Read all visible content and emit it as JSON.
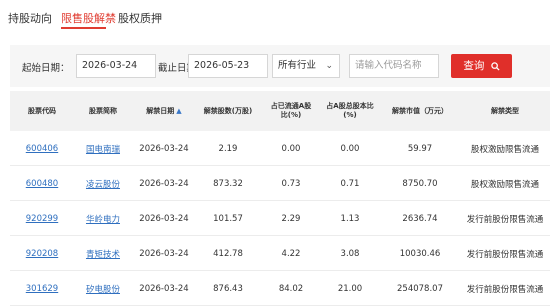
{
  "tabs": [
    {
      "label": "持股动向"
    },
    {
      "label": "限售股解禁"
    },
    {
      "label": "股权质押"
    }
  ],
  "filter": {
    "start_label": "起始日期：",
    "start_value": "2026-03-24",
    "end_label": "截止日期：",
    "end_value": "2026-05-23",
    "industry_value": "所有行业",
    "search_placeholder": "请输入代码名称",
    "query_label": "查询"
  },
  "table": {
    "headers": [
      "股票代码",
      "股票简称",
      "解禁日期",
      "解禁股数(万股)",
      "占已流通A股比(%)",
      "占A股总股本比(%)",
      "解禁市值（万元）",
      "解禁类型"
    ],
    "rows": [
      [
        "600406",
        "国电南瑞",
        "2026-03-24",
        "2.19",
        "0.00",
        "0.00",
        "59.97",
        "股权激励限售流通"
      ],
      [
        "600480",
        "凌云股份",
        "2026-03-24",
        "873.32",
        "0.73",
        "0.71",
        "8750.70",
        "股权激励限售流通"
      ],
      [
        "920299",
        "华岭电力",
        "2026-03-24",
        "101.57",
        "2.29",
        "1.13",
        "2636.74",
        "发行前股份限售流通"
      ],
      [
        "920208",
        "青矩技术",
        "2026-03-24",
        "412.78",
        "4.22",
        "3.08",
        "10030.46",
        "发行前股份限售流通"
      ],
      [
        "301629",
        "矽电股份",
        "2026-03-24",
        "876.43",
        "84.02",
        "21.00",
        "254078.07",
        "发行前股份限售流通"
      ]
    ]
  },
  "colors": {
    "accent": "#e03c31",
    "link": "#2f6fbf",
    "header_bg": "#f2f2f2",
    "filter_bg": "#f6f6f6"
  },
  "icons": {
    "query": "search-icon",
    "sort": "sort-arrow-icon",
    "dropdown": "chevron-down-icon"
  }
}
